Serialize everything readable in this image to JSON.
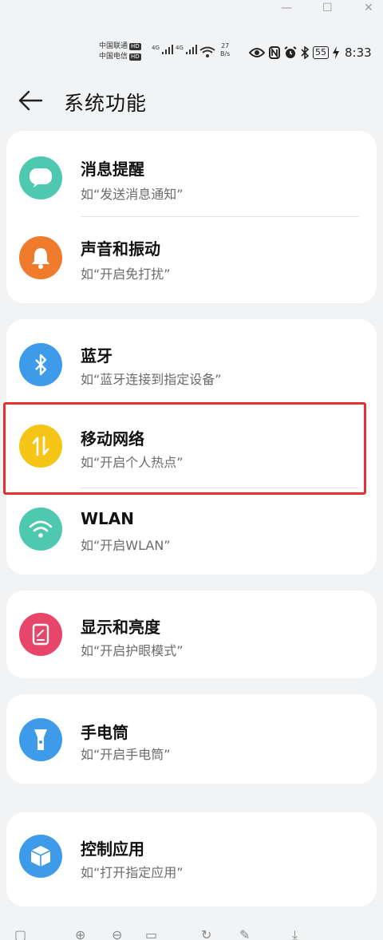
{
  "window_controls": {
    "minimize": "—",
    "restore": "☐",
    "close": "✕"
  },
  "status": {
    "carrier1": "中国联通",
    "carrier2": "中国电信",
    "hd": "HD",
    "net1": "4G",
    "net2": "4G",
    "speed_value": "27",
    "speed_unit": "B/s",
    "battery": "55",
    "time": "8:33",
    "icons": [
      "eye-icon",
      "nfc-icon",
      "alarm-icon",
      "bluetooth-icon",
      "battery-icon",
      "charging-icon"
    ]
  },
  "header": {
    "title": "系统功能",
    "back_icon": "arrow-left-icon"
  },
  "cards": [
    {
      "items": [
        {
          "title": "消息提醒",
          "subtitle": "如“发送消息通知”",
          "icon": "message-bubble-icon",
          "color": "#4ec9b0"
        },
        {
          "title": "声音和振动",
          "subtitle": "如“开启免打扰”",
          "icon": "bell-icon",
          "color": "#f07b2d"
        }
      ]
    },
    {
      "items": [
        {
          "title": "蓝牙",
          "subtitle": "如“蓝牙连接到指定设备”",
          "icon": "bluetooth-icon",
          "color": "#3d9be9"
        },
        {
          "title": "移动网络",
          "subtitle": "如“开启个人热点”",
          "icon": "data-transfer-icon",
          "color": "#f5c518"
        },
        {
          "title": "WLAN",
          "subtitle": "如“开启WLAN”",
          "icon": "wifi-icon",
          "color": "#4ec9b0"
        }
      ]
    },
    {
      "items": [
        {
          "title": "显示和亮度",
          "subtitle": "如“开启护眼模式”",
          "icon": "display-icon",
          "color": "#e8456b"
        }
      ]
    },
    {
      "items": [
        {
          "title": "手电筒",
          "subtitle": "如“开启手电筒”",
          "icon": "flashlight-icon",
          "color": "#3d9be9"
        }
      ]
    },
    {
      "items": [
        {
          "title": "控制应用",
          "subtitle": "如“打开指定应用”",
          "icon": "cube-icon",
          "color": "#3d9be9"
        }
      ]
    }
  ],
  "highlight_color": "#e53030"
}
